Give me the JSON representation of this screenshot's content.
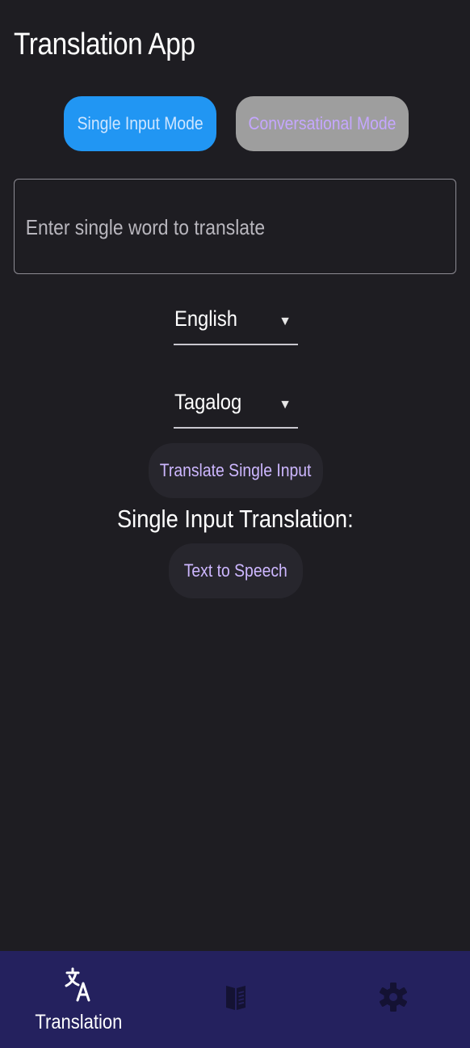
{
  "app": {
    "title": "Translation App"
  },
  "modes": {
    "single_label": "Single Input Mode",
    "conversational_label": "Conversational Mode",
    "active_color": "#2196f3",
    "inactive_color": "#9e9e9e"
  },
  "input": {
    "placeholder": "Enter single word to translate",
    "value": ""
  },
  "source_language": {
    "selected": "English"
  },
  "target_language": {
    "selected": "Tagalog"
  },
  "actions": {
    "translate_label": "Translate Single Input",
    "tts_label": "Text to Speech"
  },
  "result": {
    "label": "Single Input Translation:"
  },
  "bottom_nav": {
    "background": "#24215e",
    "items": [
      {
        "label": "Translation",
        "icon": "translate-icon",
        "active": true
      },
      {
        "label": "",
        "icon": "book-icon",
        "active": false
      },
      {
        "label": "",
        "icon": "gear-icon",
        "active": false
      }
    ]
  }
}
